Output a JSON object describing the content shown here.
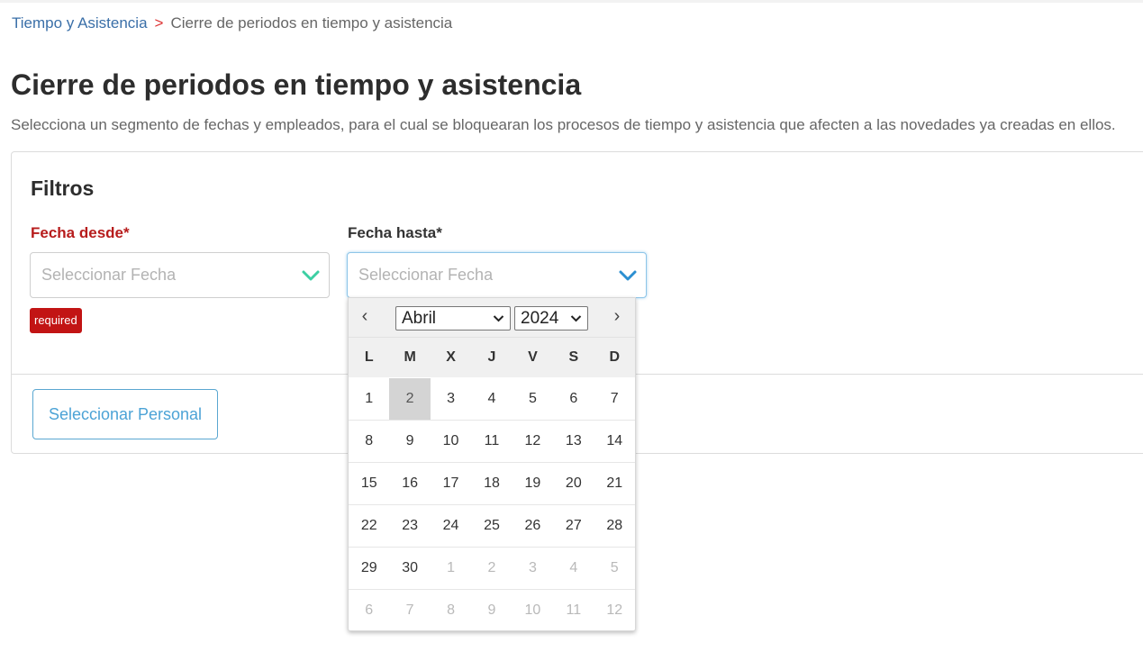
{
  "breadcrumb": {
    "parent": "Tiempo y Asistencia",
    "separator": ">",
    "current": "Cierre de periodos en tiempo y asistencia"
  },
  "page": {
    "title": "Cierre de periodos en tiempo y asistencia",
    "description": "Selecciona un segmento de fechas y empleados, para el cual se bloquearan los procesos de tiempo y asistencia que afecten a las novedades ya creadas en ellos."
  },
  "filters": {
    "title": "Filtros",
    "fecha_desde": {
      "label": "Fecha desde*",
      "placeholder": "Seleccionar Fecha",
      "error": "required"
    },
    "fecha_hasta": {
      "label": "Fecha hasta*",
      "placeholder": "Seleccionar Fecha"
    },
    "personal_button": "Seleccionar Personal"
  },
  "calendar": {
    "prev": "‹",
    "next": "›",
    "month": "Abril",
    "year": "2024",
    "weekdays": [
      "L",
      "M",
      "X",
      "J",
      "V",
      "S",
      "D"
    ],
    "selected_day": 2,
    "weeks": [
      [
        {
          "d": "1"
        },
        {
          "d": "2",
          "sel": true
        },
        {
          "d": "3"
        },
        {
          "d": "4"
        },
        {
          "d": "5"
        },
        {
          "d": "6"
        },
        {
          "d": "7"
        }
      ],
      [
        {
          "d": "8"
        },
        {
          "d": "9"
        },
        {
          "d": "10"
        },
        {
          "d": "11"
        },
        {
          "d": "12"
        },
        {
          "d": "13"
        },
        {
          "d": "14"
        }
      ],
      [
        {
          "d": "15"
        },
        {
          "d": "16"
        },
        {
          "d": "17"
        },
        {
          "d": "18"
        },
        {
          "d": "19"
        },
        {
          "d": "20"
        },
        {
          "d": "21"
        }
      ],
      [
        {
          "d": "22"
        },
        {
          "d": "23"
        },
        {
          "d": "24"
        },
        {
          "d": "25"
        },
        {
          "d": "26"
        },
        {
          "d": "27"
        },
        {
          "d": "28"
        }
      ],
      [
        {
          "d": "29"
        },
        {
          "d": "30"
        },
        {
          "d": "1",
          "o": true
        },
        {
          "d": "2",
          "o": true
        },
        {
          "d": "3",
          "o": true
        },
        {
          "d": "4",
          "o": true
        },
        {
          "d": "5",
          "o": true
        }
      ],
      [
        {
          "d": "6",
          "o": true
        },
        {
          "d": "7",
          "o": true
        },
        {
          "d": "8",
          "o": true
        },
        {
          "d": "9",
          "o": true
        },
        {
          "d": "10",
          "o": true
        },
        {
          "d": "11",
          "o": true
        },
        {
          "d": "12",
          "o": true
        }
      ]
    ]
  },
  "colors": {
    "link": "#3a6fa8",
    "error": "#c21414",
    "accent": "#4ca3d6",
    "valid_chevron": "#3ccfa3"
  }
}
